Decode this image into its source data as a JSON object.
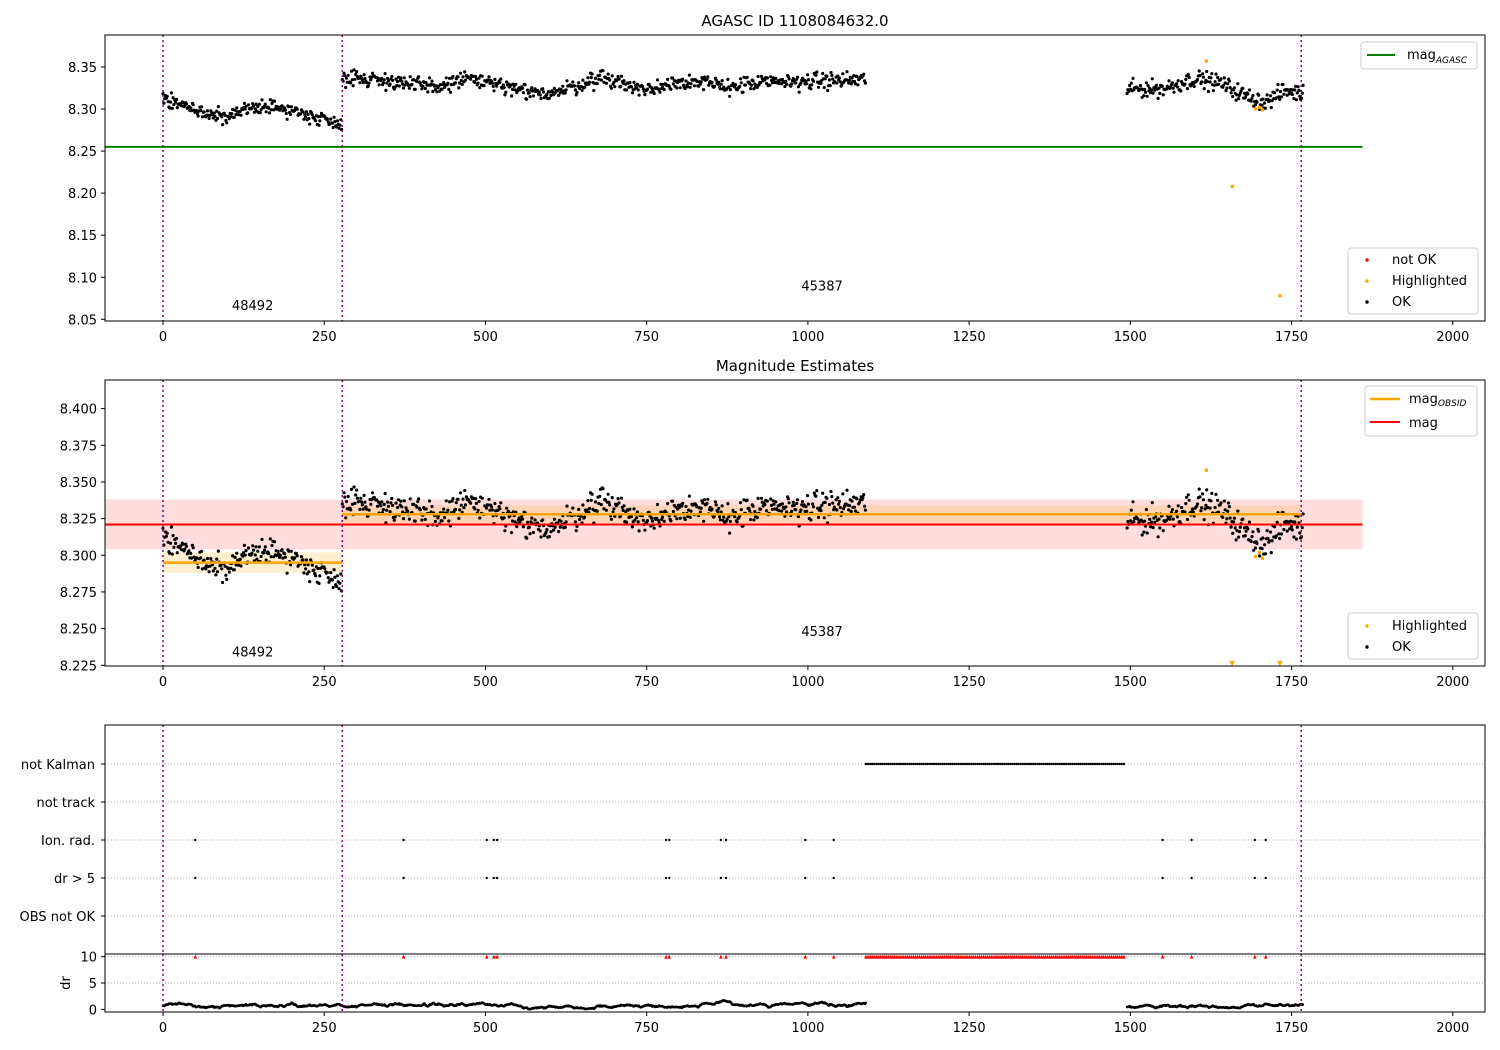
{
  "chart_data": [
    {
      "type": "scatter",
      "title": "AGASC ID 1108084632.0",
      "xlabel": "",
      "ylabel": "",
      "xlim": [
        -90,
        2050
      ],
      "ylim": [
        8.048,
        8.388
      ],
      "xticks": [
        0,
        250,
        500,
        750,
        1000,
        1250,
        1500,
        1750,
        2000
      ],
      "yticks": [
        8.05,
        8.1,
        8.15,
        8.2,
        8.25,
        8.3,
        8.35
      ],
      "grid": false,
      "segments": [
        {
          "x0": 0,
          "x1": 278,
          "obsid": "48492",
          "trend": [
            {
              "x": 0,
              "y": 8.314
            },
            {
              "x": 60,
              "y": 8.296
            },
            {
              "x": 100,
              "y": 8.289
            },
            {
              "x": 150,
              "y": 8.305
            },
            {
              "x": 200,
              "y": 8.298
            },
            {
              "x": 240,
              "y": 8.29
            },
            {
              "x": 278,
              "y": 8.282
            }
          ],
          "noise": 0.006
        },
        {
          "x0": 278,
          "x1": 1090,
          "obsid": "45387",
          "trend": [
            {
              "x": 278,
              "y": 8.338
            },
            {
              "x": 350,
              "y": 8.334
            },
            {
              "x": 420,
              "y": 8.325
            },
            {
              "x": 470,
              "y": 8.337
            },
            {
              "x": 520,
              "y": 8.328
            },
            {
              "x": 570,
              "y": 8.318
            },
            {
              "x": 620,
              "y": 8.322
            },
            {
              "x": 680,
              "y": 8.338
            },
            {
              "x": 750,
              "y": 8.322
            },
            {
              "x": 800,
              "y": 8.334
            },
            {
              "x": 870,
              "y": 8.327
            },
            {
              "x": 950,
              "y": 8.332
            },
            {
              "x": 1000,
              "y": 8.333
            },
            {
              "x": 1090,
              "y": 8.335
            }
          ],
          "noise": 0.007
        },
        {
          "x0": 1495,
          "x1": 1768,
          "obsid": "45387",
          "trend": [
            {
              "x": 1495,
              "y": 8.324
            },
            {
              "x": 1550,
              "y": 8.324
            },
            {
              "x": 1600,
              "y": 8.336
            },
            {
              "x": 1640,
              "y": 8.331
            },
            {
              "x": 1680,
              "y": 8.315
            },
            {
              "x": 1710,
              "y": 8.308
            },
            {
              "x": 1740,
              "y": 8.322
            },
            {
              "x": 1768,
              "y": 8.318
            }
          ],
          "noise": 0.007
        }
      ],
      "highlighted": [
        {
          "x": 1618,
          "y": 8.357
        },
        {
          "x": 1694,
          "y": 8.3
        },
        {
          "x": 1700,
          "y": 8.302
        },
        {
          "x": 1705,
          "y": 8.299
        },
        {
          "x": 1658,
          "y": 8.208
        },
        {
          "x": 1732,
          "y": 8.078
        }
      ],
      "hlines": [
        {
          "name": "mag_AGASC",
          "y": 8.255,
          "x0": -90,
          "x1": 1860,
          "color": "#008000"
        }
      ],
      "vlines": [
        0,
        278,
        1765
      ],
      "obsid_labels": [
        {
          "text": "48492",
          "x": 139,
          "y": 8.061
        },
        {
          "text": "45387",
          "x": 1022,
          "y": 8.084
        }
      ],
      "legends": [
        {
          "location": "upper right",
          "entries": [
            {
              "label": "mag_AGASC",
              "main": "mag",
              "sub": "AGASC",
              "kind": "line",
              "color": "#008000"
            }
          ]
        },
        {
          "location": "lower right",
          "entries": [
            {
              "label": "not OK",
              "kind": "marker",
              "color": "#ff0000"
            },
            {
              "label": "Highlighted",
              "kind": "marker",
              "color": "#ffa500"
            },
            {
              "label": "OK",
              "kind": "marker",
              "color": "#000000"
            }
          ]
        }
      ]
    },
    {
      "type": "scatter",
      "title": "Magnitude Estimates",
      "xlabel": "",
      "ylabel": "",
      "xlim": [
        -90,
        2050
      ],
      "ylim": [
        8.2245,
        8.4195
      ],
      "xticks": [
        0,
        250,
        500,
        750,
        1000,
        1250,
        1500,
        1750,
        2000
      ],
      "yticks": [
        8.225,
        8.25,
        8.275,
        8.3,
        8.325,
        8.35,
        8.375,
        8.4
      ],
      "grid": false,
      "band": {
        "x0": -90,
        "x1": 1860,
        "y0": 8.304,
        "y1": 8.338,
        "color": "#ffdddd"
      },
      "obsid_bands": [
        {
          "x0": 0,
          "x1": 278,
          "y0": 8.288,
          "y1": 8.302
        },
        {
          "x0": 278,
          "x1": 1765,
          "y0": 8.322,
          "y1": 8.334
        }
      ],
      "obsid_mags": [
        {
          "x0": 0,
          "x1": 278,
          "y": 8.295
        },
        {
          "x0": 278,
          "x1": 1765,
          "y": 8.328
        }
      ],
      "hlines": [
        {
          "name": "mag",
          "y": 8.321,
          "x0": -90,
          "x1": 1860,
          "color": "#ff0000"
        }
      ],
      "highlighted": [
        {
          "x": 1618,
          "y": 8.358
        },
        {
          "x": 1694,
          "y": 8.299
        },
        {
          "x": 1700,
          "y": 8.302
        },
        {
          "x": 1705,
          "y": 8.298
        }
      ],
      "out_of_range": [
        {
          "x": 1658,
          "y": 8.2245
        },
        {
          "x": 1732,
          "y": 8.2245
        }
      ],
      "vlines": [
        0,
        278,
        1765
      ],
      "obsid_labels": [
        {
          "text": "48492",
          "x": 139,
          "y": 8.231
        },
        {
          "text": "45387",
          "x": 1022,
          "y": 8.245
        }
      ],
      "legends": [
        {
          "location": "upper right",
          "entries": [
            {
              "label": "mag_OBSID",
              "main": "mag",
              "sub": "OBSID",
              "kind": "line",
              "color": "#ffa500"
            },
            {
              "label": "mag",
              "main": "mag",
              "sub": "",
              "kind": "line",
              "color": "#ff0000"
            }
          ]
        },
        {
          "location": "lower right",
          "entries": [
            {
              "label": "Highlighted",
              "kind": "marker",
              "color": "#ffa500"
            },
            {
              "label": "OK",
              "kind": "marker",
              "color": "#000000"
            }
          ]
        }
      ]
    },
    {
      "type": "scatter",
      "title": "",
      "xlim": [
        -90,
        2050
      ],
      "categories": [
        "not Kalman",
        "not track",
        "Ion. rad.",
        "dr > 5",
        "OBS not OK"
      ],
      "grid": "horizontal dotted",
      "not_kalman": {
        "x0": 1090,
        "x1": 1493
      },
      "flag_x": [
        50,
        373,
        502,
        513,
        518,
        780,
        785,
        865,
        873,
        996,
        1040,
        1550,
        1595,
        1693,
        1710
      ],
      "vlines": [
        0,
        278,
        1765
      ]
    },
    {
      "type": "line",
      "title": "",
      "ylabel": "dr",
      "xlim": [
        -90,
        2050
      ],
      "ylim": [
        -0.5,
        10.5
      ],
      "yticks": [
        0,
        5,
        10
      ],
      "xticks": [
        0,
        250,
        500,
        750,
        1000,
        1250,
        1500,
        1750,
        2000
      ],
      "grid": "horizontal dotted",
      "red_markers_y": 10,
      "vlines": [
        0,
        278,
        1765
      ],
      "segments": [
        {
          "x0": 0,
          "x1": 1090
        },
        {
          "x0": 1495,
          "x1": 1768
        }
      ]
    }
  ]
}
